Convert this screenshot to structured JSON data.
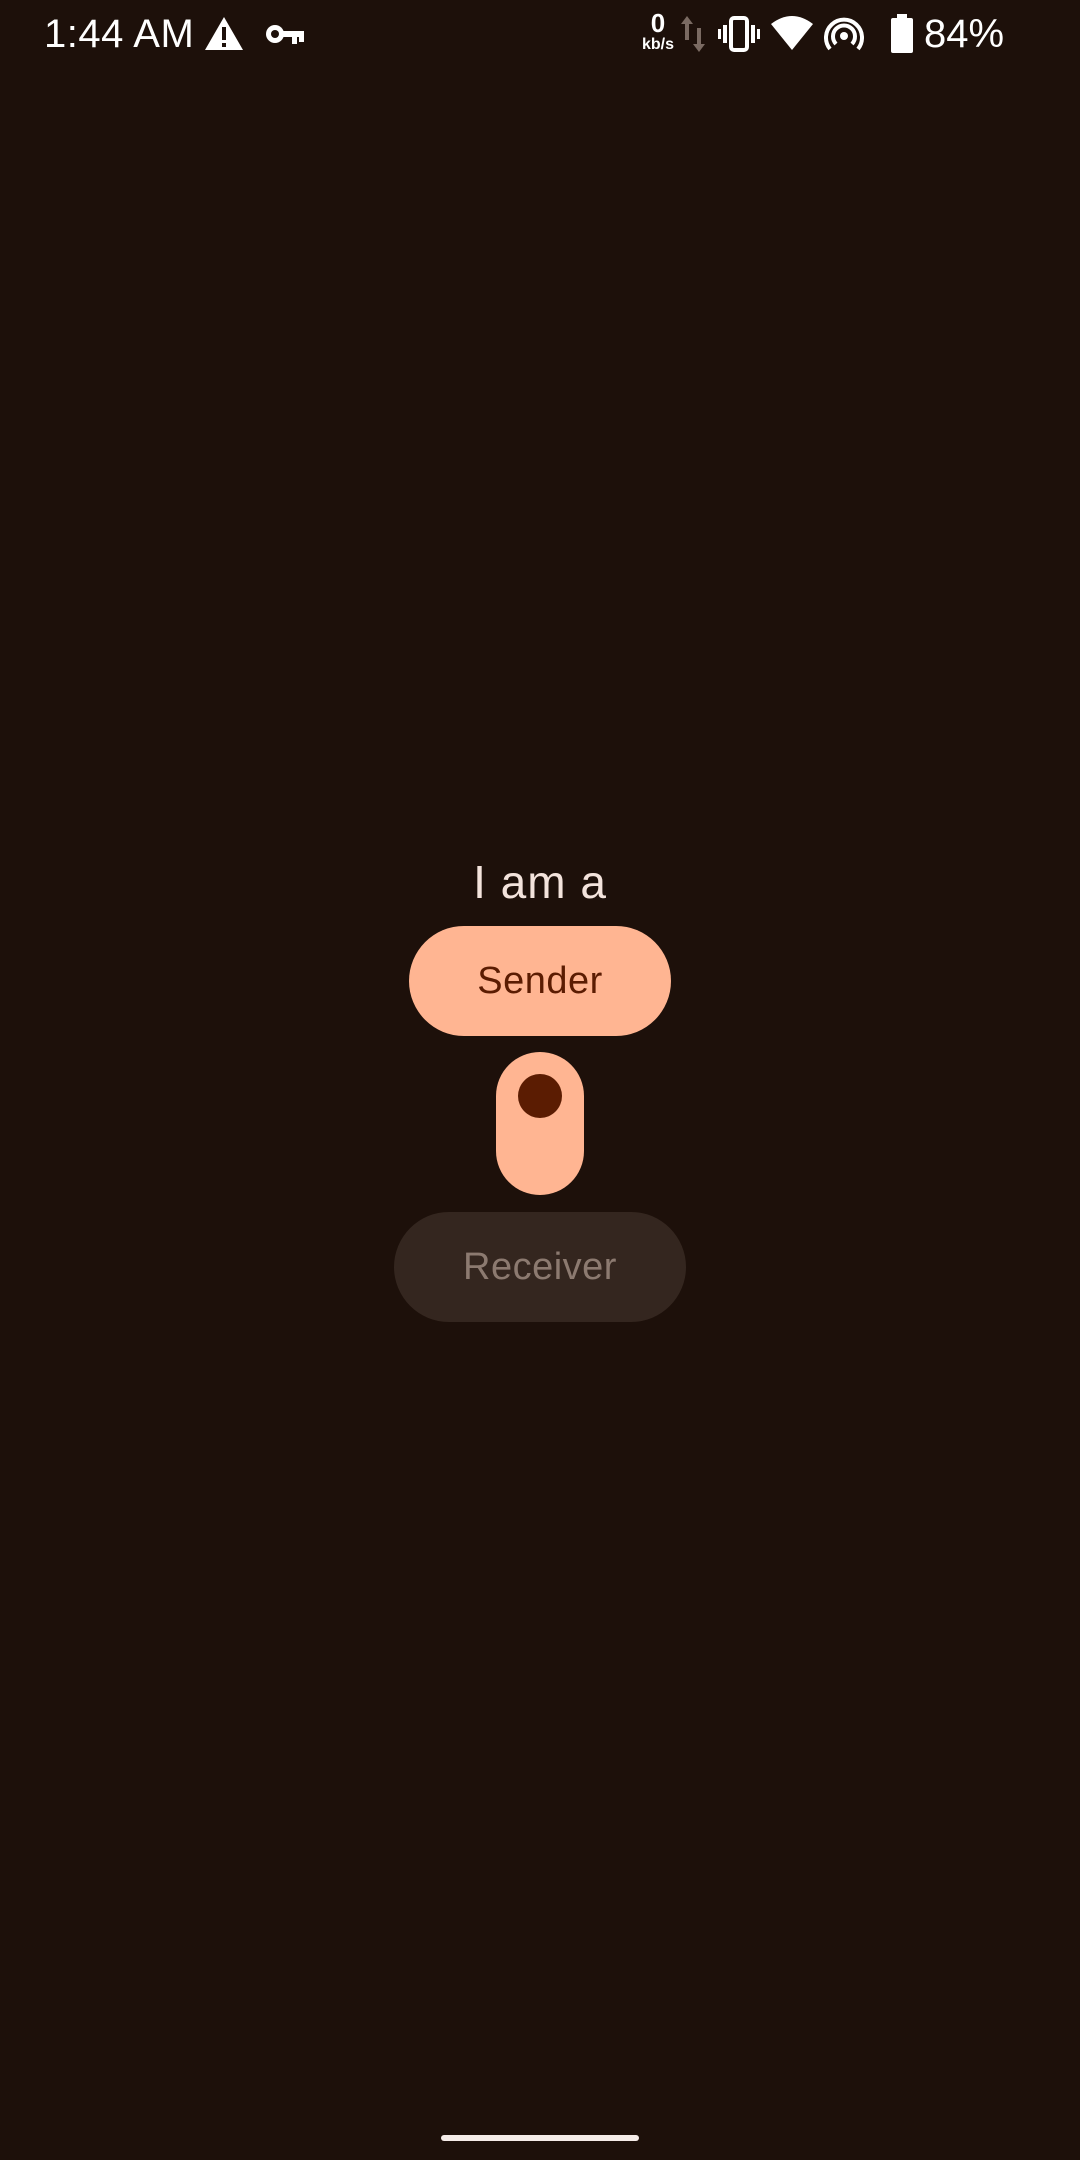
{
  "status_bar": {
    "time": "1:44 AM",
    "net_speed_value": "0",
    "net_speed_unit": "kb/s",
    "battery_percent": "84%",
    "icons": [
      "alert-icon",
      "vpn-key-icon",
      "data-arrows-icon",
      "vibrate-icon",
      "wifi-icon",
      "hotspot-icon",
      "battery-icon"
    ]
  },
  "main": {
    "prompt": "I am a",
    "sender_label": "Sender",
    "receiver_label": "Receiver",
    "toggle_state": "sender"
  },
  "colors": {
    "background": "#1d100a",
    "accent": "#ffb592",
    "accent_on": "#5b1c02",
    "inactive_bg": "#34261f",
    "inactive_text": "#8c7a70"
  }
}
